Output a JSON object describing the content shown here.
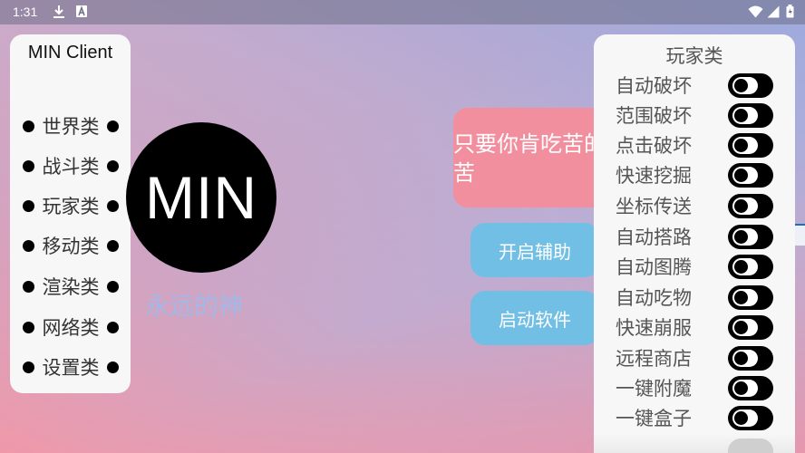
{
  "status_bar": {
    "time": "1:31",
    "icons": [
      "download-icon",
      "a-notification-icon",
      "wifi-icon",
      "signal-icon",
      "battery-icon"
    ]
  },
  "left_menu": {
    "title": "MIN Client",
    "items": [
      {
        "label": "世界类"
      },
      {
        "label": "战斗类"
      },
      {
        "label": "玩家类"
      },
      {
        "label": "移动类"
      },
      {
        "label": "渲染类"
      },
      {
        "label": "网络类"
      },
      {
        "label": "设置类"
      }
    ]
  },
  "logo": {
    "text": "MIN",
    "subtitle": "永远的神"
  },
  "message_card": {
    "text": "只要你肯吃苦的苦"
  },
  "buttons": {
    "open_assist": "开启辅助",
    "start_software": "启动软件"
  },
  "player_panel": {
    "title": "玩家类",
    "features": [
      {
        "label": "自动破坏",
        "enabled": false
      },
      {
        "label": "范围破坏",
        "enabled": false
      },
      {
        "label": "点击破坏",
        "enabled": false
      },
      {
        "label": "快速挖掘",
        "enabled": false
      },
      {
        "label": "坐标传送",
        "enabled": false
      },
      {
        "label": "自动搭路",
        "enabled": false
      },
      {
        "label": "自动图腾",
        "enabled": false
      },
      {
        "label": "自动吃物",
        "enabled": false
      },
      {
        "label": "快速崩服",
        "enabled": false
      },
      {
        "label": "远程商店",
        "enabled": false
      },
      {
        "label": "一键附魔",
        "enabled": false
      },
      {
        "label": "一键盒子",
        "enabled": false
      }
    ]
  },
  "colors": {
    "menu_bg": "#f7f7f7",
    "card_pink": "#f28f9f",
    "button_blue": "#72bfe6",
    "subtitle_blue": "#a2b8e8",
    "toggle_black": "#000000"
  }
}
